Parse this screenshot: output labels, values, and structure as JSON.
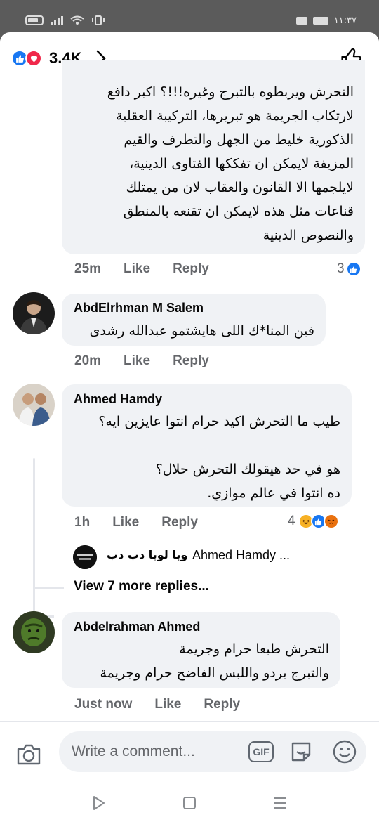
{
  "status_bar": {
    "time": "١١:٣٧"
  },
  "reactions_bar": {
    "count": "3.4K"
  },
  "comments": [
    {
      "text": "التحرش ويربطوه بالتبرج وغيره!!!؟ اكبر دافع لارتكاب الجريمة هو تبريرها، التركيبة العقلية الذكورية خليط من الجهل والتطرف والقيم المزيفة لايمكن ان تفككها الفتاوى الدينية، لايلجمها الا القانون والعقاب لان من يمتلك قناعات مثل هذه لايمكن ان تقنعه بالمنطق والنصوص الدينية",
      "lines": [
        "التحرش ويربطوه بالتبرج وغيره!!!؟ اكبر دافع",
        "لارتكاب الجريمة هو تبريرها، التركيبة العقلية",
        "الذكورية خليط من الجهل والتطرف والقيم",
        "المزيفة لايمكن ان تفككها الفتاوى الدينية،",
        "لايلجمها الا القانون والعقاب لان من يمتلك",
        "قناعات مثل هذه لايمكن ان تقنعه بالمنطق",
        "والنصوص الدينية"
      ],
      "time": "25m",
      "like": "Like",
      "reply": "Reply",
      "reactions": "3"
    },
    {
      "name": "AbdElrhman M Salem",
      "lines": [
        "فين المنا*ك اللى هايشتمو عبدالله رشدى"
      ],
      "time": "20m",
      "like": "Like",
      "reply": "Reply"
    },
    {
      "name": "Ahmed Hamdy",
      "lines": [
        "طيب ما التحرش اكيد حرام انتوا عايزين ايه؟",
        "",
        "هو في حد هيقولك التحرش حلال؟",
        "ده انتوا في عالم موازي."
      ],
      "time": "1h",
      "like": "Like",
      "reply": "Reply",
      "reactions": "4",
      "reply_preview": {
        "author": "وبا لوبا دب دب",
        "text": "Ahmed Hamdy ..."
      },
      "more_replies": "View 7 more replies..."
    },
    {
      "name": "Abdelrahman Ahmed",
      "lines": [
        "التحرش طبعا حرام وجريمة",
        "والتبرج بردو واللبس الفاضح حرام وجريمة"
      ],
      "time": "Just now",
      "like": "Like",
      "reply": "Reply"
    }
  ],
  "composer": {
    "placeholder": "Write a comment...",
    "gif_label": "GIF"
  },
  "colors": {
    "accent": "#1877f2",
    "love": "#f0284a",
    "bubble": "#f0f2f5",
    "muted_text": "#65676b"
  }
}
